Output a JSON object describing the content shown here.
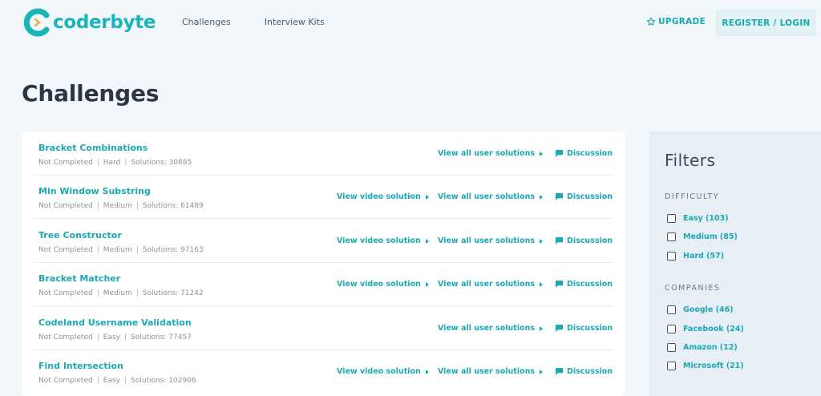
{
  "header": {
    "logo_text": "coderbyte",
    "nav": [
      "Challenges",
      "Interview Kits"
    ],
    "upgrade": "UPGRADE",
    "login": "REGISTER / LOGIN"
  },
  "page_title": "Challenges",
  "challenges": [
    {
      "title": "Bracket Combinations",
      "status": "Not Completed",
      "difficulty": "Hard",
      "solutions": "Solutions: 30885",
      "video": ""
    },
    {
      "title": "Min Window Substring",
      "status": "Not Completed",
      "difficulty": "Medium",
      "solutions": "Solutions: 61489",
      "video": "View video solution"
    },
    {
      "title": "Tree Constructor",
      "status": "Not Completed",
      "difficulty": "Medium",
      "solutions": "Solutions: 97163",
      "video": "View video solution"
    },
    {
      "title": "Bracket Matcher",
      "status": "Not Completed",
      "difficulty": "Medium",
      "solutions": "Solutions: 71242",
      "video": "View video solution"
    },
    {
      "title": "Codeland Username Validation",
      "status": "Not Completed",
      "difficulty": "Easy",
      "solutions": "Solutions: 77457",
      "video": ""
    },
    {
      "title": "Find Intersection",
      "status": "Not Completed",
      "difficulty": "Easy",
      "solutions": "Solutions: 102906",
      "video": "View video solution"
    }
  ],
  "links": {
    "user_solutions": "View all user solutions",
    "discussion": "Discussion"
  },
  "filters": {
    "title": "Filters",
    "difficulty_label": "DIFFICULTY",
    "difficulty": [
      "Easy (103)",
      "Medium (85)",
      "Hard (57)"
    ],
    "companies_label": "COMPANIES",
    "companies": [
      "Google (46)",
      "Facebook (24)",
      "Amazon (12)",
      "Microsoft (21)"
    ]
  },
  "colors": {
    "accent": "#1aa9b3",
    "background": "#f2f7fc",
    "filters_bg": "#e8eef5"
  }
}
